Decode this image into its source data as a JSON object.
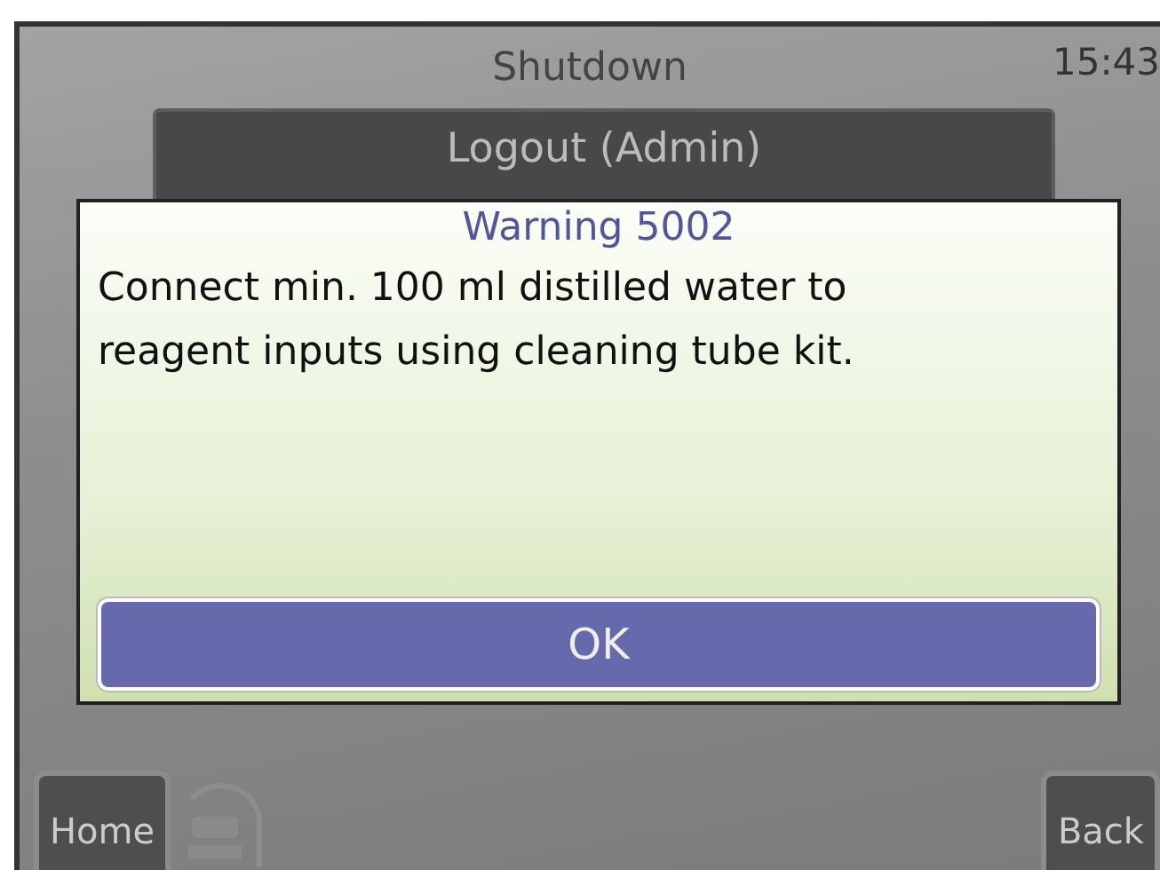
{
  "header": {
    "title": "Shutdown",
    "time": "15:43"
  },
  "menu": [
    {
      "label": "Logout (Admin)"
    }
  ],
  "dialog": {
    "title": "Warning 5002",
    "message": "Connect min. 100 ml distilled water to reagent inputs using cleaning tube kit.",
    "button": "OK"
  },
  "footer": {
    "left_button": "Home",
    "right_button": "Back"
  }
}
